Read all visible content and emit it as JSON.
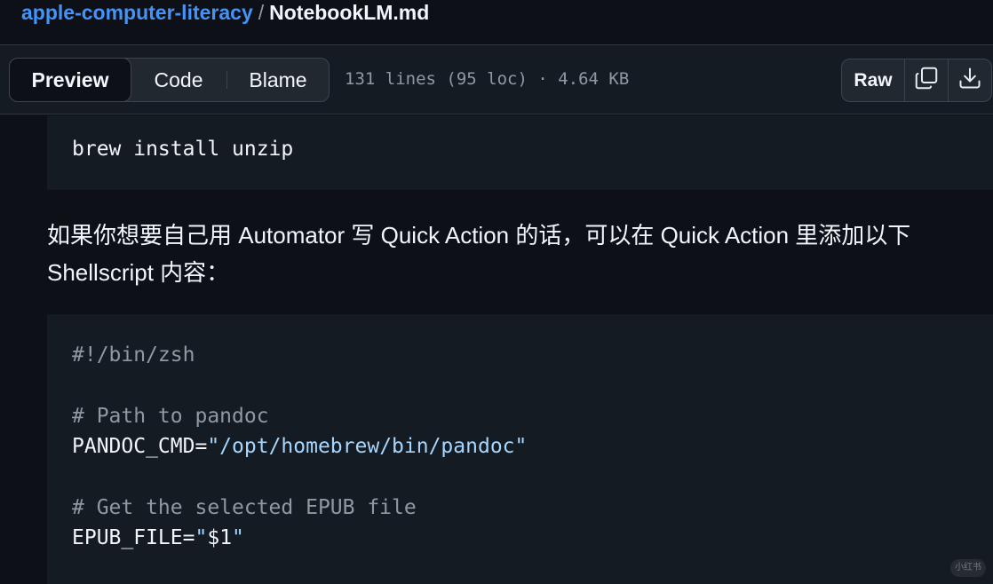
{
  "breadcrumb": {
    "repo": "apple-computer-literacy",
    "separator": "/",
    "file": "NotebookLM.md"
  },
  "toolbar": {
    "tabs": [
      {
        "label": "Preview",
        "active": true
      },
      {
        "label": "Code",
        "active": false
      },
      {
        "label": "Blame",
        "active": false
      }
    ],
    "file_meta": "131 lines (95 loc) · 4.64 KB",
    "raw_label": "Raw",
    "copy_icon": "copy-icon",
    "download_icon": "download-icon"
  },
  "content": {
    "code_block_1": {
      "lines": [
        "brew install unzip"
      ]
    },
    "paragraph": {
      "line1": "如果你想要自己用 Automator 写 Quick Action 的话，可以在 Quick Action 里添加以下",
      "line2": "Shellscript 内容："
    },
    "code_block_2": {
      "shebang": "#!/bin/zsh",
      "comment1": "# Path to pandoc",
      "pandoc_var": "PANDOC_CMD=",
      "pandoc_value": "\"/opt/homebrew/bin/pandoc\"",
      "comment2": "# Get the selected EPUB file",
      "epub_var": "EPUB_FILE=",
      "epub_value_open": "\"",
      "epub_value_body": "$1",
      "epub_value_close": "\""
    }
  },
  "watermark": "小红书",
  "colors": {
    "background": "#0d1117",
    "link": "#4493f8",
    "string": "#a5d6ff",
    "comment": "#9198a1"
  }
}
